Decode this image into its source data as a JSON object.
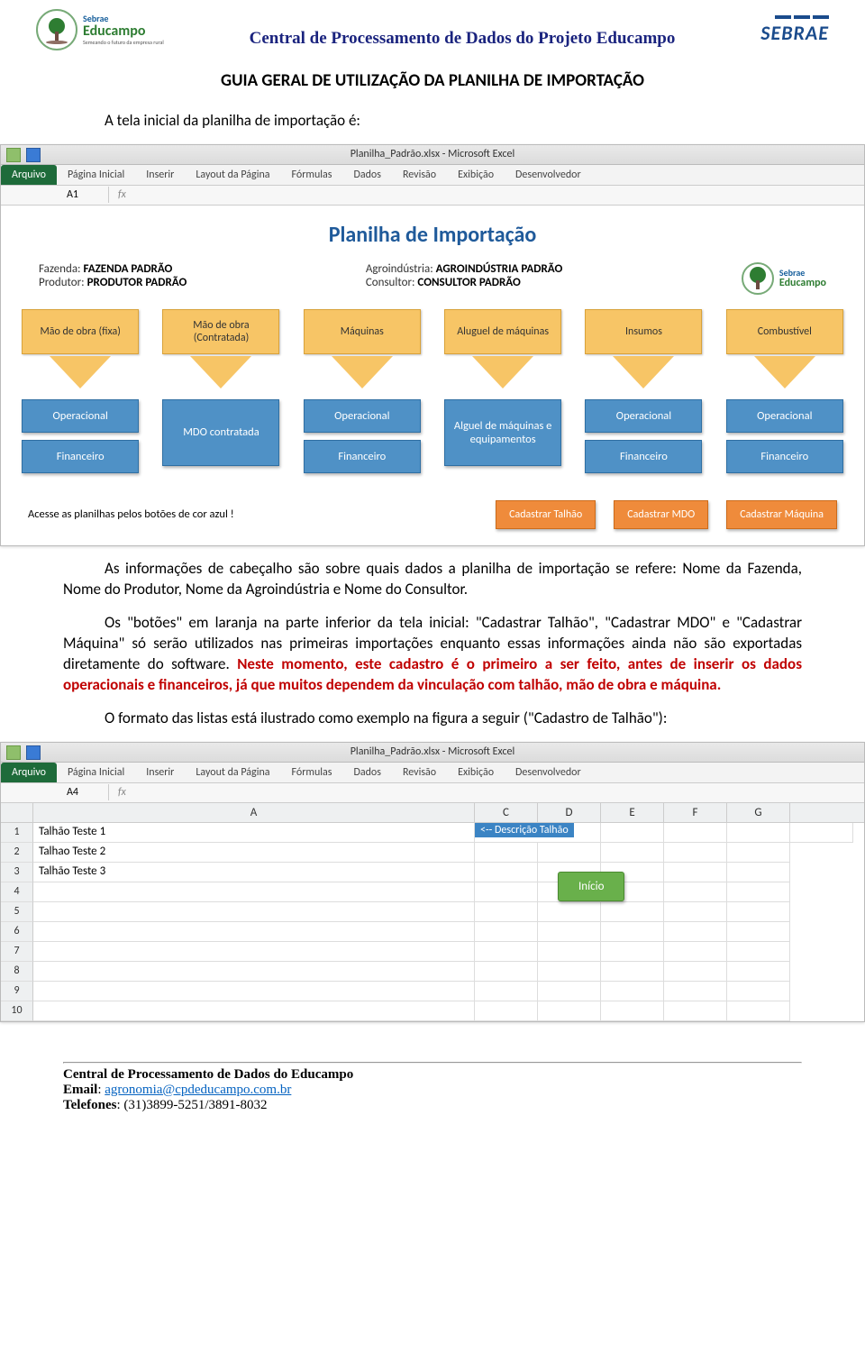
{
  "header": {
    "logo_top": "Sebrae",
    "logo_main": "Educampo",
    "logo_tag": "Semeando o futuro da empresa rural",
    "center_title": "Central de Processamento de Dados do Projeto Educampo",
    "sebrae": "SEBRAE"
  },
  "doc": {
    "title": "GUIA GERAL DE UTILIZAÇÃO DA PLANILHA DE IMPORTAÇÃO",
    "intro": "A tela inicial da planilha de importação é:",
    "p1": "As informações de cabeçalho são sobre quais dados a planilha de importação se refere: Nome da Fazenda, Nome do Produtor, Nome da Agroindústria e Nome do Consultor.",
    "p2a": "Os \"botões\" em laranja na parte inferior da tela inicial: \"Cadastrar Talhão\", \"Cadastrar MDO\" e \"Cadastrar Máquina\" só serão utilizados nas primeiras importações enquanto essas informações ainda não são exportadas diretamente do software. ",
    "p2b": "Neste momento, este cadastro é o primeiro a ser feito, antes de inserir os dados operacionais e financeiros, já que muitos dependem da vinculação com talhão, mão de obra e máquina.",
    "p3": "O formato das listas está ilustrado como exemplo na figura a seguir (\"Cadastro de Talhão\"):"
  },
  "shot1": {
    "window_title": "Planilha_Padrão.xlsx - Microsoft Excel",
    "tabs": [
      "Arquivo",
      "Página Inicial",
      "Inserir",
      "Layout da Página",
      "Fórmulas",
      "Dados",
      "Revisão",
      "Exibição",
      "Desenvolvedor"
    ],
    "namebox": "A1",
    "sheet_title": "Planilha de Importação",
    "fields": {
      "fazenda_lbl": "Fazenda:",
      "fazenda_val": "FAZENDA PADRÃO",
      "produtor_lbl": "Produtor:",
      "produtor_val": "PRODUTOR PADRÃO",
      "agro_lbl": "Agroindústria:",
      "agro_val": "AGROINDÚSTRIA PADRÃO",
      "consultor_lbl": "Consultor:",
      "consultor_val": "CONSULTOR PADRÃO"
    },
    "columns": [
      {
        "top": "Mão de obra (fixa)",
        "blues": [
          "Operacional",
          "Financeiro"
        ]
      },
      {
        "top": "Mão de obra (Contratada)",
        "blues": [
          "MDO contratada"
        ]
      },
      {
        "top": "Máquinas",
        "blues": [
          "Operacional",
          "Financeiro"
        ]
      },
      {
        "top": "Aluguel de máquinas",
        "blues": [
          "Alguel de máquinas e equipamentos"
        ]
      },
      {
        "top": "Insumos",
        "blues": [
          "Operacional",
          "Financeiro"
        ]
      },
      {
        "top": "Combustível",
        "blues": [
          "Operacional",
          "Financeiro"
        ]
      }
    ],
    "note": "Acesse as planilhas pelos botões de cor azul !",
    "orange_buttons": [
      "Cadastrar Talhão",
      "Cadastrar MDO",
      "Cadastrar Máquina"
    ]
  },
  "shot2": {
    "window_title": "Planilha_Padrão.xlsx - Microsoft Excel",
    "tabs": [
      "Arquivo",
      "Página Inicial",
      "Inserir",
      "Layout da Página",
      "Fórmulas",
      "Dados",
      "Revisão",
      "Exibição",
      "Desenvolvedor"
    ],
    "namebox": "A4",
    "cols": [
      "A",
      "C",
      "D",
      "E",
      "F",
      "G"
    ],
    "rows": [
      {
        "n": "1",
        "a": "Talhão Teste 1",
        "c": "<-- Descrição Talhão"
      },
      {
        "n": "2",
        "a": "Talhao Teste 2",
        "c": ""
      },
      {
        "n": "3",
        "a": "Talhão Teste 3",
        "c": ""
      },
      {
        "n": "4",
        "a": "",
        "c": ""
      },
      {
        "n": "5",
        "a": "",
        "c": ""
      },
      {
        "n": "6",
        "a": "",
        "c": ""
      },
      {
        "n": "7",
        "a": "",
        "c": ""
      },
      {
        "n": "8",
        "a": "",
        "c": ""
      },
      {
        "n": "9",
        "a": "",
        "c": ""
      },
      {
        "n": "10",
        "a": "",
        "c": ""
      }
    ],
    "green_btn": "Início"
  },
  "footer": {
    "l1": "Central de Processamento de Dados do Educampo",
    "l2_lbl": "Email",
    "l2_val": "agronomia@cpdeducampo.com.br",
    "l3_lbl": "Telefones",
    "l3_val": "(31)3899-5251/3891-8032"
  }
}
